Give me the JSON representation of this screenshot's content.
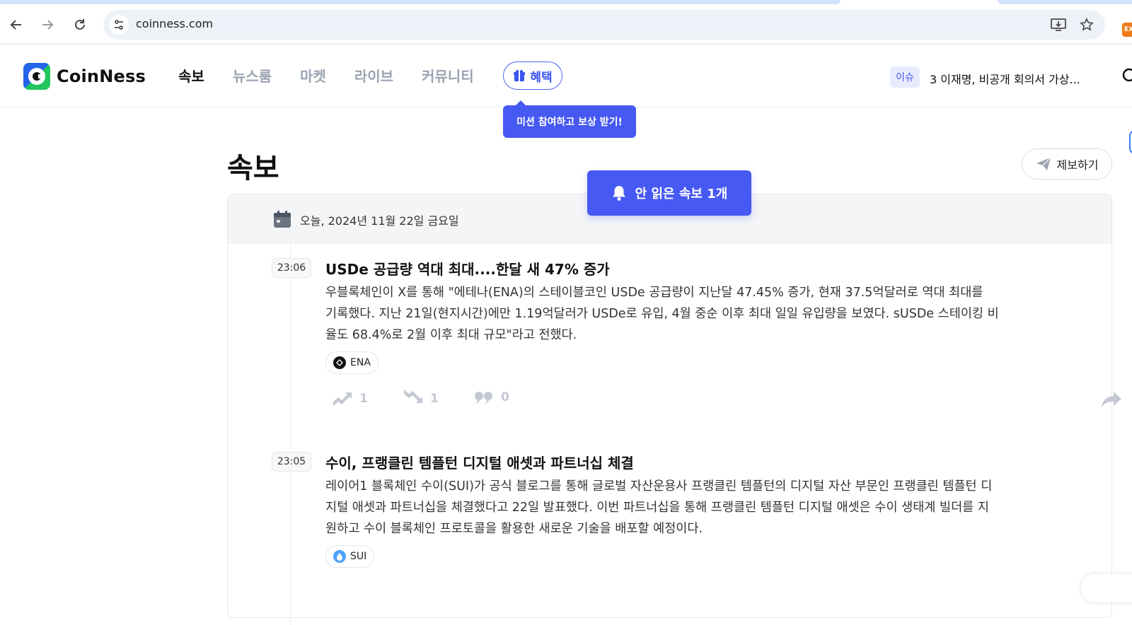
{
  "browser": {
    "url": "coinness.com",
    "extension_label": "EX"
  },
  "header": {
    "logo_text": "CoinNess",
    "nav": [
      {
        "label": "속보",
        "active": true
      },
      {
        "label": "뉴스룸",
        "active": false
      },
      {
        "label": "마켓",
        "active": false
      },
      {
        "label": "라이브",
        "active": false
      },
      {
        "label": "커뮤니티",
        "active": false
      }
    ],
    "benefit_label": "혜택",
    "benefit_tooltip": "미션 참여하고 보상 받기!",
    "issue_badge": "이슈",
    "issue_text": "3 이재명, 비공개 회의서 가상..."
  },
  "page": {
    "title": "속보",
    "report_button": "제보하기",
    "unread_banner": "안 읽은 속보 1개",
    "date_label": "오늘, 2024년 11월 22일 금요일"
  },
  "articles": [
    {
      "time": "23:06",
      "title": "USDe 공급량 역대 최대....한달 새 47% 증가",
      "body_lines": [
        "우블록체인이 X를 통해 \"에테나(ENA)의 스테이블코인 USDe 공급량이 지난달 47.45% 증가, 현재  37.5억달러로 역대 최대를",
        "기록했다. 지난 21일(현지시간)에만 1.19억달러가 USDe로 유입, 4월 중순 이후 최대 일일 유입량을 보였다. sUSDe 스테이킹 비",
        "율도 68.4%로 2월 이후 최대 규모\"라고 전했다."
      ],
      "coin": "ENA",
      "bullish_count": "1",
      "bearish_count": "1",
      "comment_count": "0"
    },
    {
      "time": "23:05",
      "title": "수이, 프랭클린 템플턴 디지털 애셋과 파트너십 체결",
      "body_lines": [
        "레이어1 블록체인 수이(SUI)가 공식 블로그를 통해 글로벌 자산운용사 프랭클린 템플턴의 디지털 자산 부문인 프랭클린 템플턴 디",
        "지털 애셋과 파트너십을 체결했다고 22일 발표했다. 이번 파트너십을 통해 프랭클린 템플턴 디지털 애셋은 수이 생태계 빌더를 지",
        "원하고 수이 블록체인 프로토콜을 활용한 새로운 기술을 배포할 예정이다."
      ],
      "coin": "SUI"
    }
  ],
  "colors": {
    "accent": "#4659f2",
    "muted_icon": "#c3c8d2",
    "logo_green": "#22c55e",
    "logo_blue": "#2563eb"
  }
}
